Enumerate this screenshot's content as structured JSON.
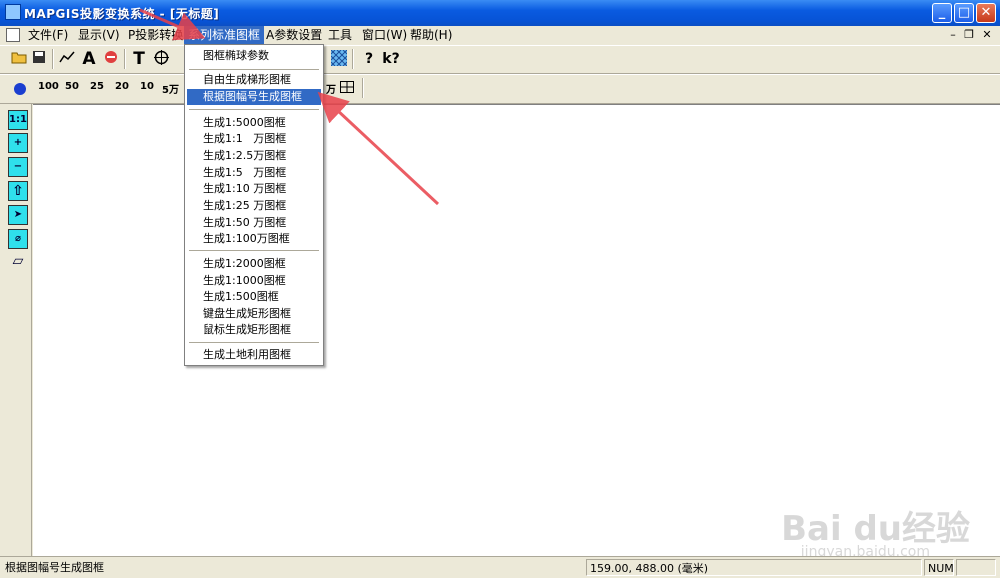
{
  "window": {
    "title": "MAPGIS投影变换系统 - [无标题]",
    "min_label": "_",
    "max_label": "□",
    "close_label": "✕"
  },
  "menubar": {
    "items": [
      "文件(F)",
      "显示(V)",
      "P投影转换",
      "系列标准图框",
      "A参数设置",
      "工具",
      "窗口(W)",
      "帮助(H)"
    ],
    "active_index": 3,
    "mdi_min": "–",
    "mdi_restore": "❐",
    "mdi_close": "✕"
  },
  "toolbar1": {
    "icons": [
      "open-folder-icon",
      "save-icon",
      "line-icon",
      "text-a-icon",
      "no-entry-icon",
      "text-t-icon",
      "crosshair-icon"
    ],
    "label_a": "A",
    "label_t": "T",
    "label_help": "?",
    "label_whats_this": "k?"
  },
  "toolbar2": {
    "scales": [
      "100",
      "50",
      "25",
      "20",
      "10",
      "5万"
    ],
    "extra_label": "万"
  },
  "leftbar": {
    "buttons": [
      {
        "name": "actual-size-icon",
        "label": "1:1"
      },
      {
        "name": "zoom-in-icon",
        "label": "+"
      },
      {
        "name": "zoom-out-icon",
        "label": "−"
      },
      {
        "name": "home-up-icon",
        "label": "⇧"
      },
      {
        "name": "pan-icon",
        "label": "➤"
      },
      {
        "name": "attach-icon",
        "label": "⌀"
      },
      {
        "name": "eraser-icon",
        "label": "▱"
      }
    ]
  },
  "dropdown": {
    "items": [
      {
        "label": "图框椭球参数",
        "highlighted": false,
        "sep_after": true
      },
      {
        "label": "自由生成梯形图框",
        "highlighted": false,
        "sep_after": false
      },
      {
        "label": "根据图幅号生成图框",
        "highlighted": true,
        "sep_after": true
      },
      {
        "label": "生成1:5000图框",
        "highlighted": false,
        "sep_after": false
      },
      {
        "label": "生成1:1   万图框",
        "highlighted": false,
        "sep_after": false
      },
      {
        "label": "生成1:2.5万图框",
        "highlighted": false,
        "sep_after": false
      },
      {
        "label": "生成1:5   万图框",
        "highlighted": false,
        "sep_after": false
      },
      {
        "label": "生成1:10 万图框",
        "highlighted": false,
        "sep_after": false
      },
      {
        "label": "生成1:25 万图框",
        "highlighted": false,
        "sep_after": false
      },
      {
        "label": "生成1:50 万图框",
        "highlighted": false,
        "sep_after": false
      },
      {
        "label": "生成1:100万图框",
        "highlighted": false,
        "sep_after": true
      },
      {
        "label": "生成1:2000图框",
        "highlighted": false,
        "sep_after": false
      },
      {
        "label": "生成1:1000图框",
        "highlighted": false,
        "sep_after": false
      },
      {
        "label": "生成1:500图框",
        "highlighted": false,
        "sep_after": false
      },
      {
        "label": "键盘生成矩形图框",
        "highlighted": false,
        "sep_after": false
      },
      {
        "label": "鼠标生成矩形图框",
        "highlighted": false,
        "sep_after": true
      },
      {
        "label": "生成土地利用图框",
        "highlighted": false,
        "sep_after": false
      }
    ]
  },
  "statusbar": {
    "message": "根据图幅号生成图框",
    "coords": "159.00, 488.00 (毫米)",
    "num": "NUM"
  },
  "watermark": {
    "brand": "Bai du经验",
    "url": "jingyan.baidu.com"
  },
  "colors": {
    "titlebar": "#0a5be0",
    "highlight": "#316ac5",
    "annotation_arrow": "#e8414a",
    "tool_cyan": "#2fe0ec"
  }
}
